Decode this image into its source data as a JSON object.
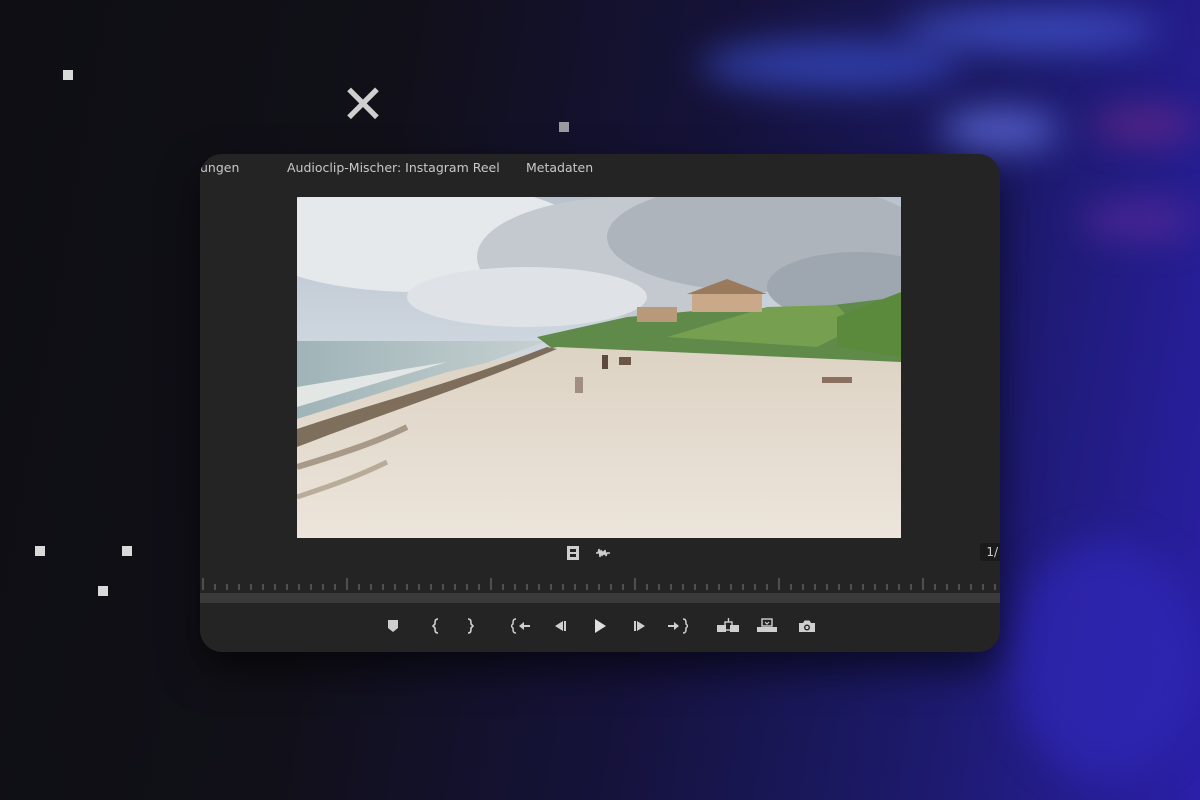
{
  "tabs": [
    {
      "label": "ungen"
    },
    {
      "label": "Audioclip-Mischer: Instagram Reel"
    },
    {
      "label": "Metadaten"
    }
  ],
  "timecode_fraction": "1/",
  "icons": {
    "close": "close-icon",
    "clip": "film-clip-icon",
    "audio": "audio-waveform-icon",
    "marker": "add-marker-icon",
    "mark_in": "mark-in-icon",
    "mark_out": "mark-out-icon",
    "go_to_in": "go-to-in-icon",
    "step_back": "step-back-icon",
    "play": "play-icon",
    "step_forward": "step-forward-icon",
    "go_to_out": "go-to-out-icon",
    "insert": "insert-icon",
    "overwrite": "overwrite-icon",
    "export_frame": "camera-icon"
  },
  "colors": {
    "panel_bg": "#242424",
    "icon": "#cfcfcf",
    "background_accent": "#2a1fa8"
  }
}
